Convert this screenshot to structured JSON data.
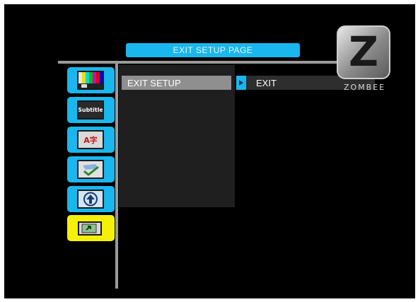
{
  "header": {
    "title": "EXIT SETUP PAGE"
  },
  "brand": {
    "logo_text": "ZOMBEE",
    "logo_letter": "Z"
  },
  "sidebar": {
    "tabs": [
      {
        "icon": "tv-test-pattern-icon",
        "active": false
      },
      {
        "icon": "subtitle-icon",
        "label": "Subtitle",
        "active": false
      },
      {
        "icon": "language-icon",
        "label": "A字",
        "active": false
      },
      {
        "icon": "preferences-icon",
        "active": false
      },
      {
        "icon": "upgrade-arrow-icon",
        "active": false
      },
      {
        "icon": "exit-icon",
        "active": true
      }
    ]
  },
  "menu": {
    "items": [
      {
        "label": "EXIT SETUP",
        "selected": true
      }
    ]
  },
  "options": {
    "items": [
      {
        "label": "EXIT"
      }
    ]
  },
  "colors": {
    "accent": "#1ab7ee",
    "active_tab": "#f4f00a",
    "background": "#000000",
    "highlight": "#8f8f8f"
  }
}
